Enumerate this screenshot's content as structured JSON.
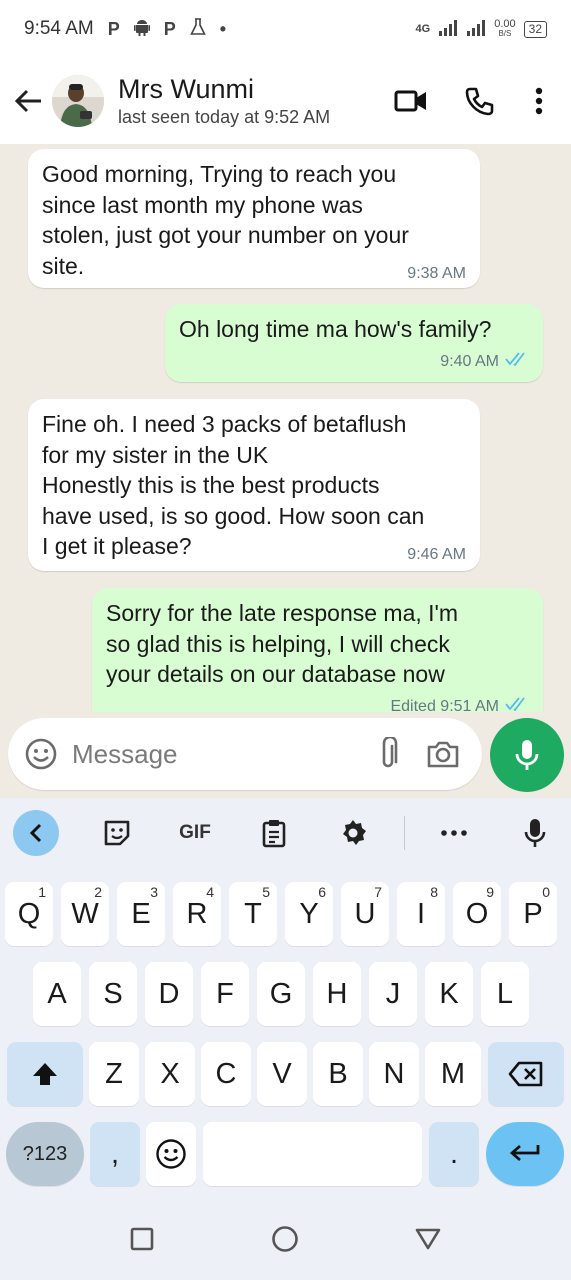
{
  "status_bar": {
    "time": "9:54 AM",
    "left_icons": [
      "P",
      "android-icon",
      "P",
      "flask-icon",
      "•"
    ],
    "network_label": "4G",
    "data_speed": "0.00",
    "data_unit": "B/S",
    "battery": "32"
  },
  "header": {
    "contact_name": "Mrs Wunmi",
    "contact_status": "last seen today at 9:52 AM",
    "icons": [
      "back-arrow-icon",
      "video-call-icon",
      "voice-call-icon",
      "more-vert-icon"
    ]
  },
  "messages": [
    {
      "direction": "in",
      "text": "Good morning, Trying to reach you\nsince last month my phone was\nstolen, just got your number on your\nsite.",
      "time": "9:38 AM"
    },
    {
      "direction": "out",
      "text": "Oh long time ma how's family?",
      "time": "9:40 AM",
      "read": true
    },
    {
      "direction": "in",
      "text": "Fine oh. I need 3 packs of betaflush\nfor my sister in the UK\nHonestly this is the best products\nhave used, is so good. How soon can\nI get it please?",
      "time": "9:46 AM"
    },
    {
      "direction": "out",
      "text": "Sorry for the late response ma, I'm\nso glad this is helping, I will check\nyour details on our database now",
      "time": "Edited 9:51 AM",
      "read": true
    }
  ],
  "composer": {
    "placeholder": "Message",
    "icons": [
      "emoji-icon",
      "attach-icon",
      "camera-icon",
      "mic-icon"
    ]
  },
  "keyboard": {
    "toolbar": [
      "collapse-icon",
      "sticker-icon",
      "GIF",
      "clipboard-icon",
      "settings-icon",
      "more-icon",
      "voice-input-icon"
    ],
    "row1": [
      "Q",
      "W",
      "E",
      "R",
      "T",
      "Y",
      "U",
      "I",
      "O",
      "P"
    ],
    "row1_hints": [
      "1",
      "2",
      "3",
      "4",
      "5",
      "6",
      "7",
      "8",
      "9",
      "0"
    ],
    "row2": [
      "A",
      "S",
      "D",
      "F",
      "G",
      "H",
      "J",
      "K",
      "L"
    ],
    "row3": [
      "Z",
      "X",
      "C",
      "V",
      "B",
      "N",
      "M"
    ],
    "sym_label": "?123",
    "comma": ",",
    "period": "."
  },
  "colors": {
    "chat_bg": "#efeae2",
    "outgoing_bubble": "#d9fdd3",
    "incoming_bubble": "#ffffff",
    "mic_green": "#1eaa61",
    "read_ticks": "#53bdeb",
    "keyboard_bg": "#eef0f7"
  }
}
